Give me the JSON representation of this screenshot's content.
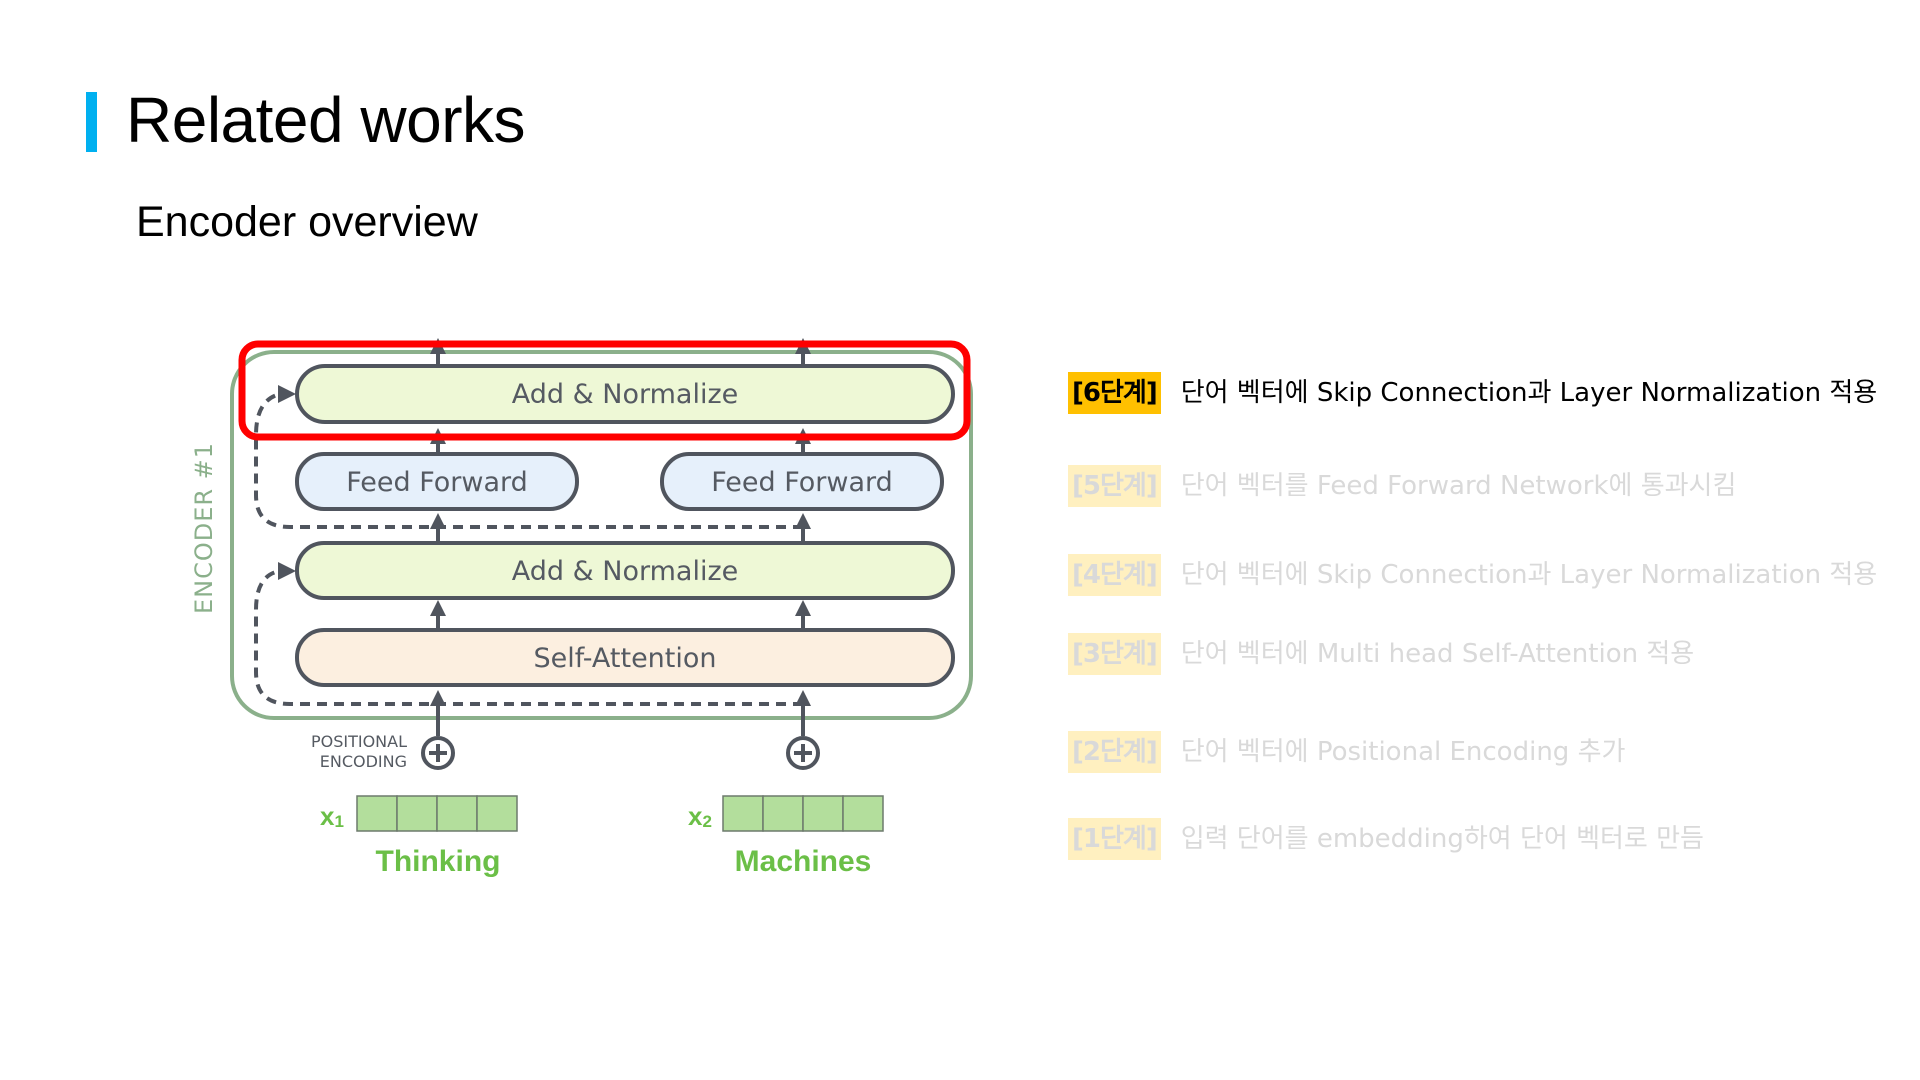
{
  "slide": {
    "title": "Related works",
    "subtitle": "Encoder overview",
    "accent_color": "#00B0F0"
  },
  "diagram": {
    "encoder_label": "ENCODER #1",
    "blocks": {
      "add_normalize_top": "Add & Normalize",
      "feed_forward_left": "Feed Forward",
      "feed_forward_right": "Feed Forward",
      "add_normalize_bottom": "Add & Normalize",
      "self_attention": "Self-Attention"
    },
    "positional_encoding_line1": "POSITIONAL",
    "positional_encoding_line2": "ENCODING",
    "inputs": [
      {
        "var": "x",
        "sub": "1",
        "word": "Thinking",
        "cells": 4
      },
      {
        "var": "x",
        "sub": "2",
        "word": "Machines",
        "cells": 4
      }
    ],
    "highlight_color": "#FF0000",
    "highlighted_block": "add_normalize_top"
  },
  "steps": [
    {
      "badge": "[6단계]",
      "text": "단어 벡터에 Skip Connection과 Layer Normalization 적용",
      "active": true
    },
    {
      "badge": "[5단계]",
      "text": "단어 벡터를 Feed Forward Network에 통과시킴",
      "active": false
    },
    {
      "badge": "[4단계]",
      "text": "단어 벡터에 Skip Connection과 Layer Normalization 적용",
      "active": false
    },
    {
      "badge": "[3단계]",
      "text": "단어 벡터에 Multi head Self-Attention 적용",
      "active": false
    },
    {
      "badge": "[2단계]",
      "text": "단어 벡터에 Positional Encoding 추가",
      "active": false
    },
    {
      "badge": "[1단계]",
      "text": "입력 단어를 embedding하여 단어 벡터로 만듬",
      "active": false
    }
  ],
  "badge_color": "#FFC000"
}
